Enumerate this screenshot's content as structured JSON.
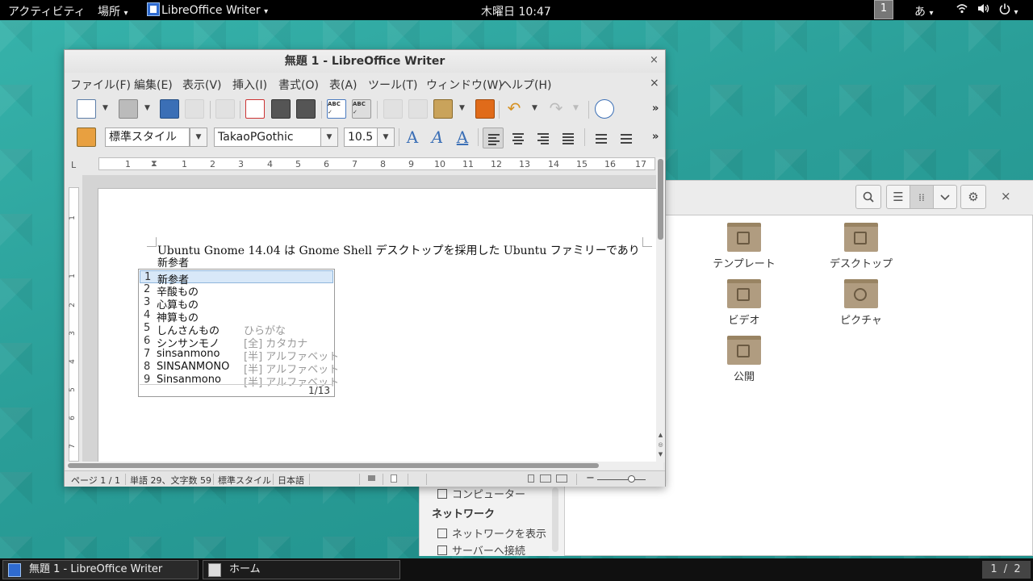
{
  "topbar": {
    "activities": "アクティビティ",
    "places": "場所",
    "app_menu": "LibreOffice Writer",
    "clock": "木曜日 10:47",
    "workspace": "1",
    "input_method": "あ",
    "arrow": "▾"
  },
  "writer": {
    "title": "無題 1 - LibreOffice Writer",
    "close": "×",
    "menu": [
      "ファイル(F)",
      "編集(E)",
      "表示(V)",
      "挿入(I)",
      "書式(O)",
      "表(A)",
      "ツール(T)",
      "ウィンドウ(W)",
      "ヘルプ(H)"
    ],
    "menu_close": "×",
    "overflow": "»",
    "para_style": "標準スタイル",
    "font_name": "TakaoPGothic",
    "font_size": "10.5",
    "ruler_left": "L",
    "ruler": [
      "1",
      "1",
      "2",
      "3",
      "4",
      "5",
      "6",
      "7",
      "8",
      "9",
      "10",
      "11",
      "12",
      "13",
      "14",
      "15",
      "16",
      "17"
    ],
    "vruler": [
      "1",
      "1",
      "2",
      "3",
      "4",
      "5",
      "6",
      "7"
    ],
    "doc_line1": "Ubuntu Gnome 14.04 は Gnome Shell デスクトップを採用した Ubuntu ファミリーであり",
    "doc_line2": "新参者",
    "status": {
      "page": "ページ 1 / 1",
      "words": "単語 29、文字数 59",
      "style": "標準スタイル",
      "language": "日本語"
    }
  },
  "ime": {
    "candidates": [
      {
        "num": "1",
        "word": "新参者",
        "desc": ""
      },
      {
        "num": "2",
        "word": "辛酸もの",
        "desc": ""
      },
      {
        "num": "3",
        "word": "心算もの",
        "desc": ""
      },
      {
        "num": "4",
        "word": "神算もの",
        "desc": ""
      },
      {
        "num": "5",
        "word": "しんさんもの",
        "desc": "ひらがな"
      },
      {
        "num": "6",
        "word": "シンサンモノ",
        "desc": "[全] カタカナ"
      },
      {
        "num": "7",
        "word": "sinsanmono",
        "desc": "[半] アルファベット"
      },
      {
        "num": "8",
        "word": "SINSANMONO",
        "desc": "[半] アルファベット"
      },
      {
        "num": "9",
        "word": "Sinsanmono",
        "desc": "[半] アルファベット"
      }
    ],
    "count": "1/13"
  },
  "files": {
    "close": "×",
    "icons": [
      "テンプレート",
      "デスクトップ",
      "ビデオ",
      "ピクチャ",
      "公開"
    ],
    "sidebar": {
      "computer": "コンピューター",
      "network_heading": "ネットワーク",
      "browse_network": "ネットワークを表示",
      "connect_server": "サーバーへ接続"
    }
  },
  "taskbar": {
    "writer": "無題 1 - LibreOffice Writer",
    "home": "ホーム",
    "pager": "1 / 2"
  },
  "colors": {
    "desktop": "#2a9d97",
    "panel": "#000000",
    "accent": "#3b6fb6"
  }
}
